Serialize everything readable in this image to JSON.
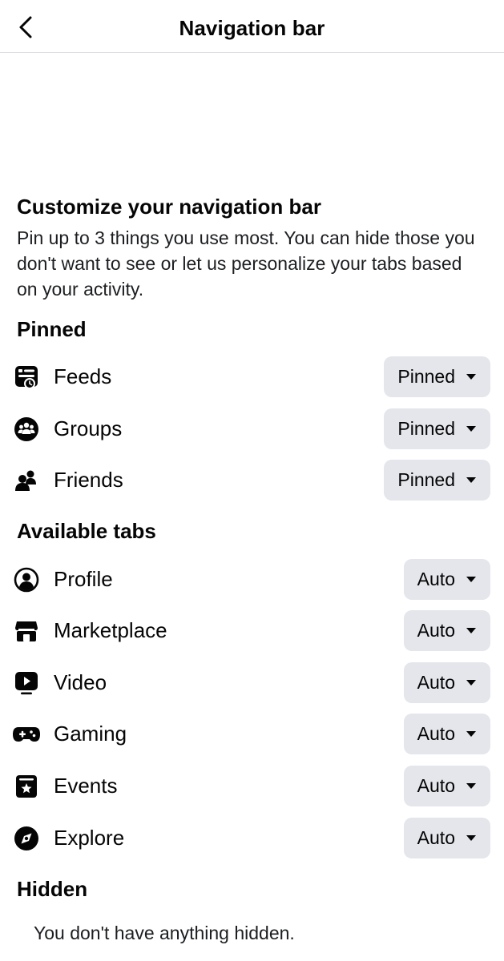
{
  "header": {
    "title": "Navigation bar",
    "back_icon": "chevron-left-icon"
  },
  "intro": {
    "title": "Customize your navigation bar",
    "description": "Pin up to 3 things you use most. You can hide those you don't want to see or let us personalize your tabs based on your activity."
  },
  "pinned": {
    "title": "Pinned",
    "items": [
      {
        "label": "Feeds",
        "icon": "feeds-icon",
        "status": "Pinned"
      },
      {
        "label": "Groups",
        "icon": "groups-icon",
        "status": "Pinned"
      },
      {
        "label": "Friends",
        "icon": "friends-icon",
        "status": "Pinned"
      }
    ]
  },
  "available": {
    "title": "Available tabs",
    "items": [
      {
        "label": "Profile",
        "icon": "profile-icon",
        "status": "Auto"
      },
      {
        "label": "Marketplace",
        "icon": "marketplace-icon",
        "status": "Auto"
      },
      {
        "label": "Video",
        "icon": "video-icon",
        "status": "Auto"
      },
      {
        "label": "Gaming",
        "icon": "gaming-icon",
        "status": "Auto"
      },
      {
        "label": "Events",
        "icon": "events-icon",
        "status": "Auto"
      },
      {
        "label": "Explore",
        "icon": "explore-icon",
        "status": "Auto"
      }
    ]
  },
  "hidden": {
    "title": "Hidden",
    "empty_text": "You don't have anything hidden."
  },
  "colors": {
    "pill_background": "#e4e6eb",
    "text_primary": "#050505",
    "divider": "#dadde1"
  }
}
